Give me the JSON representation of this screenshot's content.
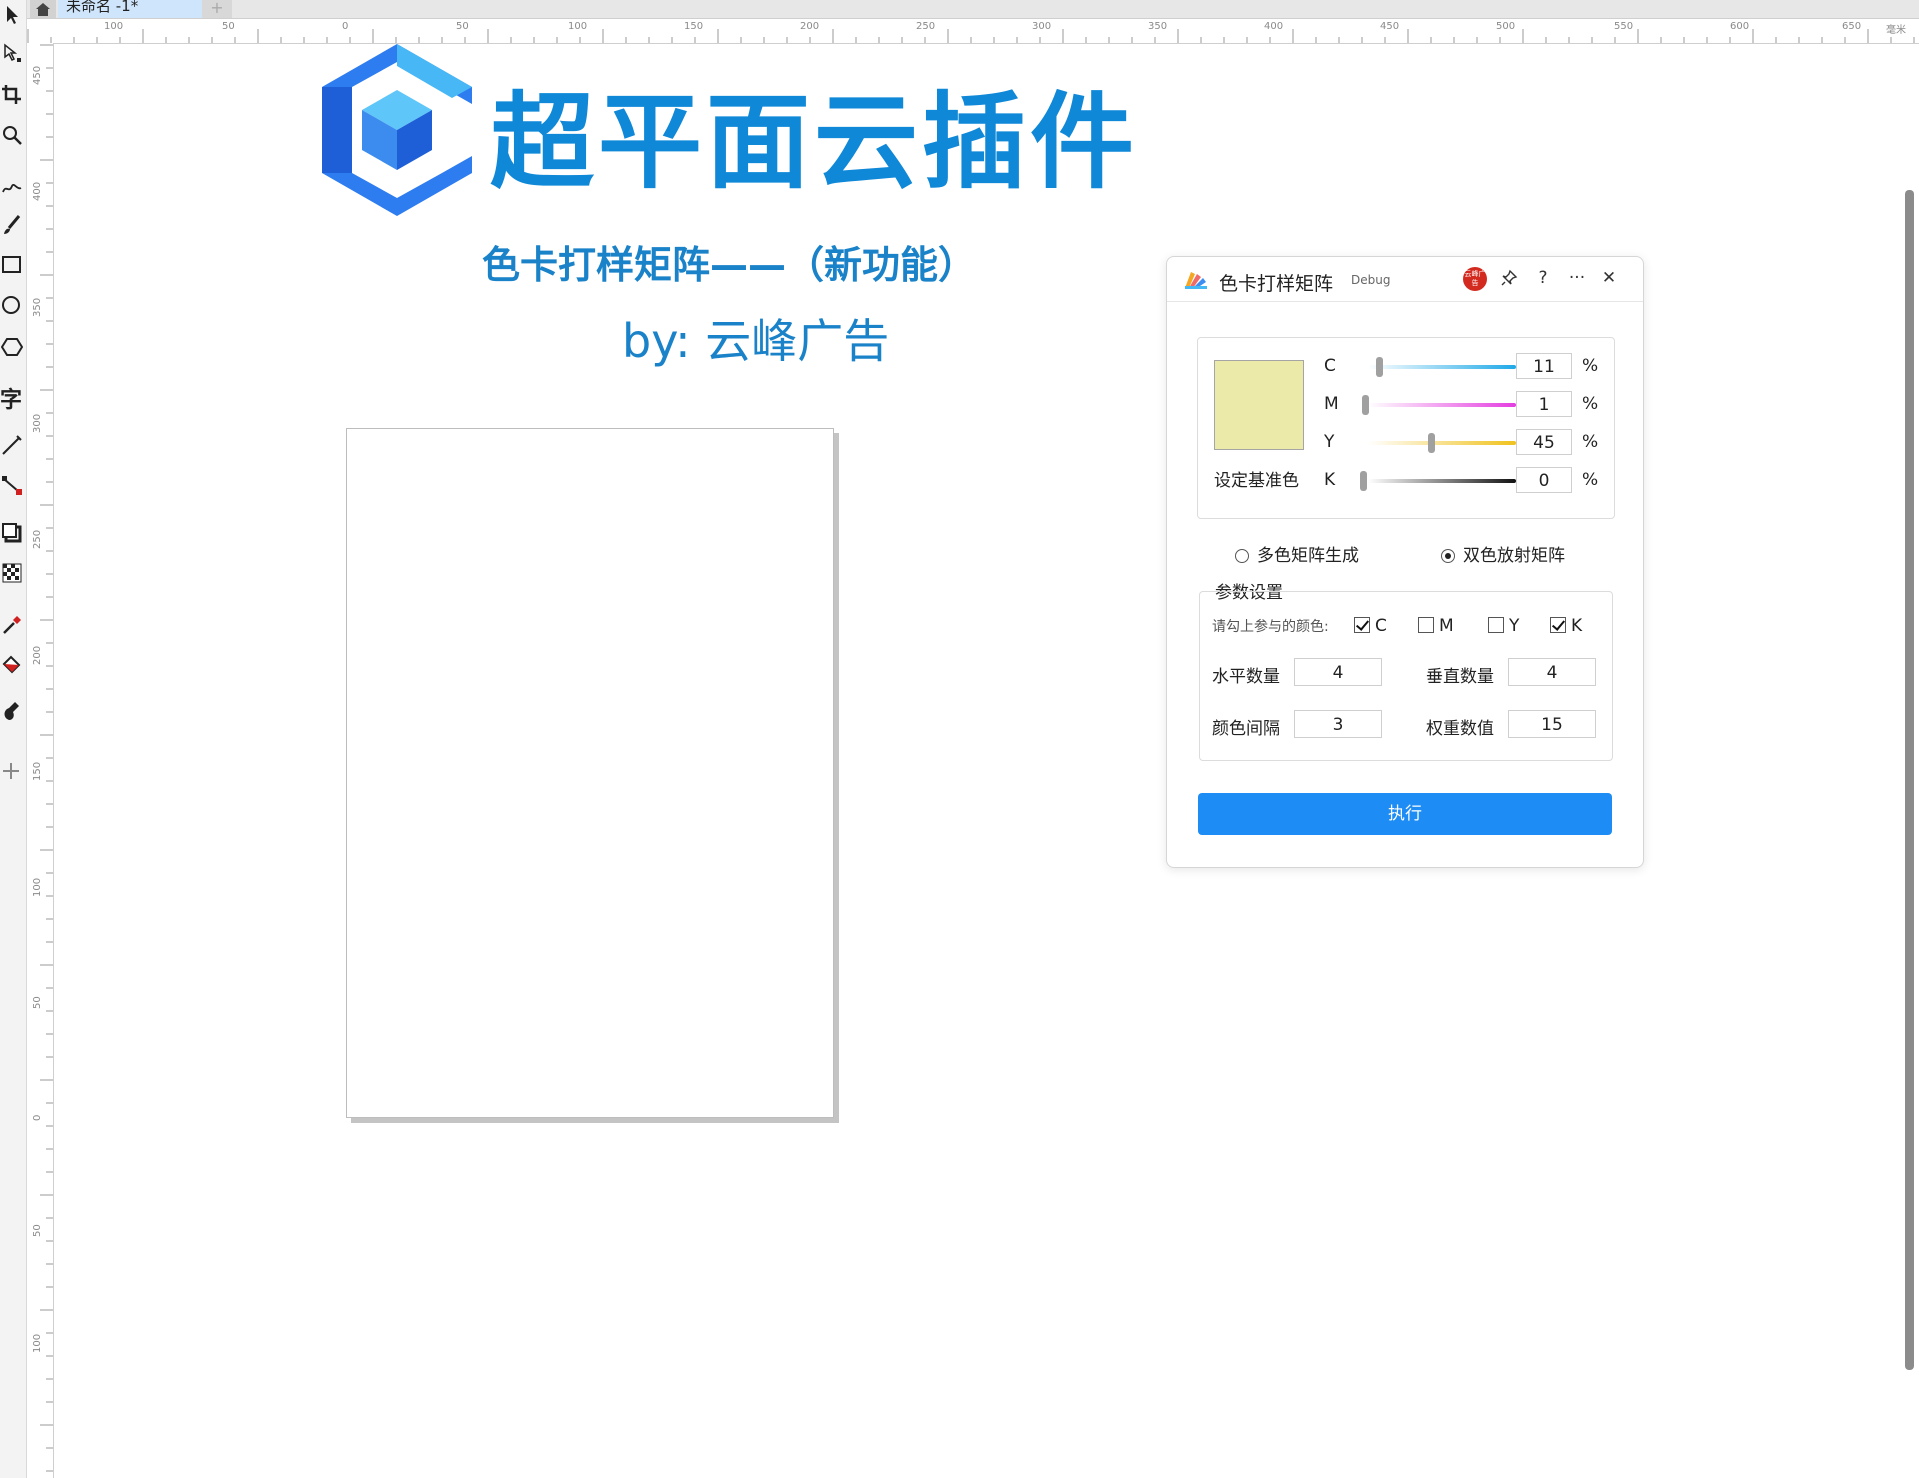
{
  "document": {
    "tab_title": "未命名 -1*",
    "new_tab": "+"
  },
  "ruler": {
    "horizontal_ticks": [
      "100",
      "50",
      "0",
      "50",
      "100",
      "150",
      "200",
      "250",
      "300",
      "350",
      "400",
      "450",
      "500",
      "550",
      "600",
      "650"
    ],
    "unit": "毫米",
    "vertical_ticks": [
      "450",
      "400",
      "350",
      "300",
      "250",
      "200",
      "150",
      "100",
      "50",
      "0",
      "50",
      "100"
    ]
  },
  "toolbox": {
    "tools": [
      "pick-tool-icon",
      "shape-tool-icon",
      "crop-tool-icon",
      "zoom-tool-icon",
      "freehand-tool-icon",
      "artistic-media-icon",
      "rectangle-tool-icon",
      "ellipse-tool-icon",
      "polygon-tool-icon",
      "text-tool-icon",
      "parallel-dimension-icon",
      "connector-tool-icon",
      "drop-shadow-icon",
      "transparency-icon",
      "eyedropper-icon",
      "interactive-fill-icon",
      "smart-fill-icon",
      "add-tool-icon"
    ],
    "text_tool_glyph": "字"
  },
  "canvas": {
    "brand_title": "超平面云插件",
    "subtitle": "色卡打样矩阵——（新功能）",
    "author": "by: 云峰广告",
    "logo_colors": [
      "#2d7cf0",
      "#47b8f5",
      "#1e5fd8"
    ]
  },
  "dialog": {
    "title": "色卡打样矩阵",
    "badge": "Debug",
    "avatar_text": "云峰广告",
    "buttons": {
      "pin": "pin-icon",
      "help": "?",
      "more": "···",
      "close": "✕"
    },
    "base_color_label": "设定基准色",
    "swatch_color": "#ebeaa9",
    "cmyk": [
      {
        "channel": "C",
        "value": "11",
        "unit": "%",
        "level": 0.11,
        "color": "#1ea9e8"
      },
      {
        "channel": "M",
        "value": "1",
        "unit": "%",
        "level": 0.01,
        "color": "#e43de0"
      },
      {
        "channel": "Y",
        "value": "45",
        "unit": "%",
        "level": 0.45,
        "color": "#f0c21c"
      },
      {
        "channel": "K",
        "value": "0",
        "unit": "%",
        "level": 0.0,
        "color": "#111111"
      }
    ],
    "modes": [
      {
        "label": "多色矩阵生成",
        "selected": false
      },
      {
        "label": "双色放射矩阵",
        "selected": true
      }
    ],
    "params": {
      "title": "参数设置",
      "participate_label": "请勾上参与的颜色:",
      "channels": [
        {
          "label": "C",
          "checked": true
        },
        {
          "label": "M",
          "checked": false
        },
        {
          "label": "Y",
          "checked": false
        },
        {
          "label": "K",
          "checked": true
        }
      ],
      "horizontal_count_label": "水平数量",
      "horizontal_count": "4",
      "vertical_count_label": "垂直数量",
      "vertical_count": "4",
      "color_spacing_label": "颜色间隔",
      "color_spacing": "3",
      "weight_label": "权重数值",
      "weight": "15"
    },
    "execute_label": "执行"
  }
}
